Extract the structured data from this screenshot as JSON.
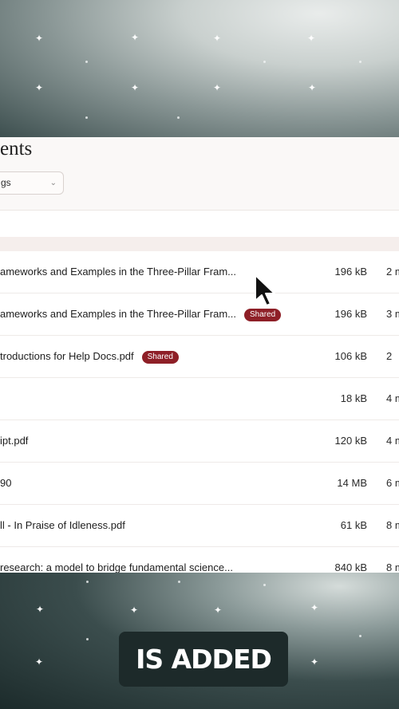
{
  "page": {
    "title_fragment": "ents"
  },
  "filters": {
    "tags_label": "gs"
  },
  "files": [
    {
      "name": "ameworks and Examples in the Three-Pillar Fram...",
      "badge": "",
      "size": "196 kB",
      "date": "2 m"
    },
    {
      "name": "ameworks and Examples in the Three-Pillar Fram...",
      "badge": "Shared",
      "size": "196 kB",
      "date": "3 m"
    },
    {
      "name": "troductions for Help Docs.pdf",
      "badge": "Shared",
      "size": "106 kB",
      "date": "2"
    },
    {
      "name": "",
      "badge": "",
      "size": "18 kB",
      "date": "4 m"
    },
    {
      "name": "ipt.pdf",
      "badge": "",
      "size": "120 kB",
      "date": "4 m"
    },
    {
      "name": "90",
      "badge": "",
      "size": "14 MB",
      "date": "6 m"
    },
    {
      "name": "ll - In Praise of Idleness.pdf",
      "badge": "",
      "size": "61 kB",
      "date": "8 m"
    },
    {
      "name": " research: a model to bridge fundamental science...",
      "badge": "",
      "size": "840 kB",
      "date": "8 m"
    }
  ],
  "caption": {
    "text": "IS ADDED"
  },
  "colors": {
    "badge_bg": "#8e1f27",
    "panel_bg": "#faf8f7",
    "caption_bg": "#1d2a2a"
  },
  "icons": {
    "select_chevron": "chevron-down-icon",
    "pointer": "mouse-cursor-icon",
    "decor": "sparkle-icon"
  }
}
